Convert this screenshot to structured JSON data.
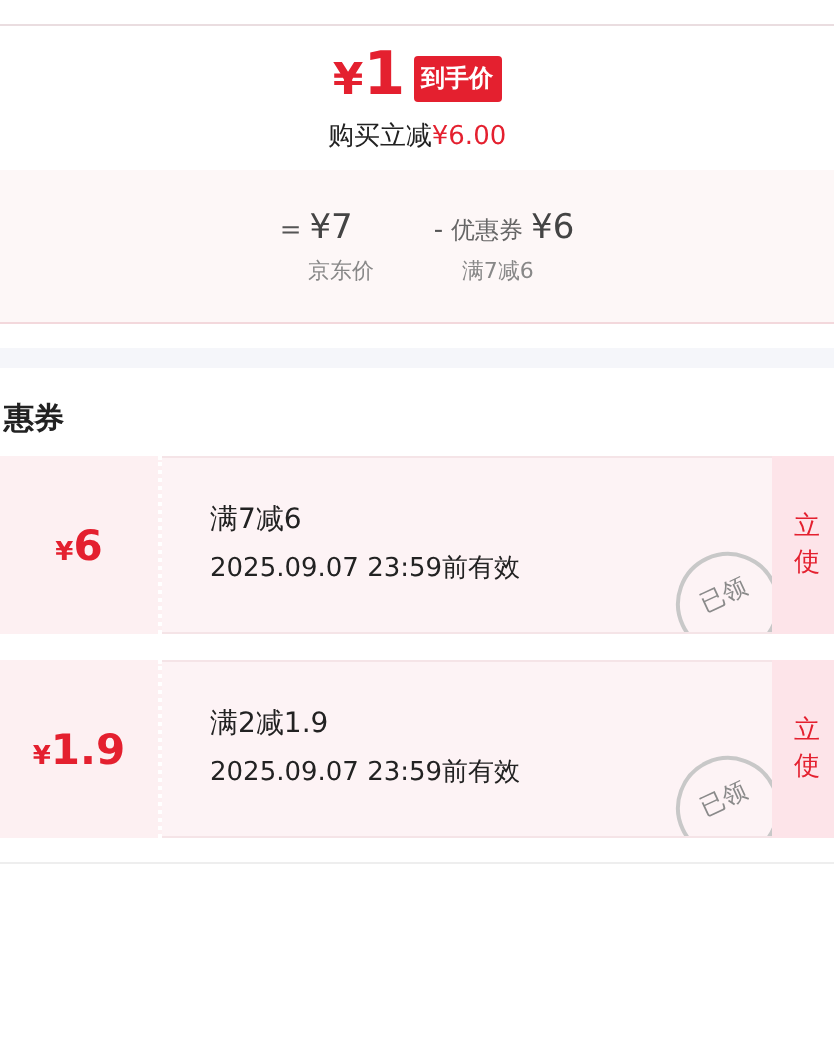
{
  "price": {
    "currency": "¥",
    "amount": "1",
    "badge": "到手价",
    "saving_label": "购买立减",
    "saving_amount": "¥6.00"
  },
  "breakdown": [
    {
      "sign": "=",
      "value": "¥7",
      "caption": "京东价"
    },
    {
      "sign": "-",
      "prefix": "优惠券",
      "value": "¥6",
      "caption": "满7减6"
    }
  ],
  "coupons_section": {
    "title": "惠券",
    "coupons": [
      {
        "currency": "¥",
        "amount": "6",
        "condition": "满7减6",
        "validity": "2025.09.07 23:59前有效",
        "stamp": "已领",
        "action_lines": [
          "立",
          "使"
        ]
      },
      {
        "currency": "¥",
        "amount": "1.9",
        "condition": "满2减1.9",
        "validity": "2025.09.07 23:59前有效",
        "stamp": "已领",
        "action_lines": [
          "立",
          "使"
        ]
      }
    ]
  }
}
